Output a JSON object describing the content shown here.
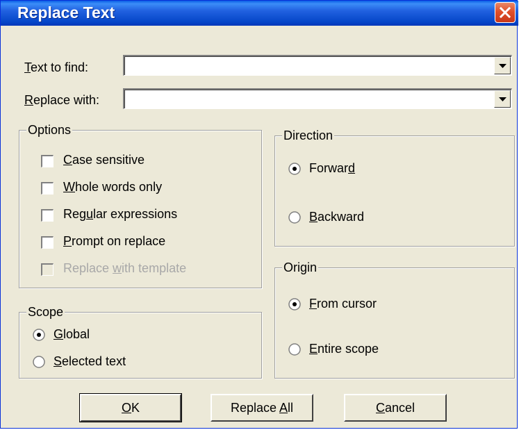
{
  "title": "Replace Text",
  "fields": {
    "find_label": {
      "hot": "T",
      "rest": "ext to find:"
    },
    "find_value": "",
    "replace_label": {
      "hot": "R",
      "rest": "eplace with:"
    },
    "replace_value": ""
  },
  "options": {
    "title": "Options",
    "items": [
      {
        "pre": "",
        "hot": "C",
        "post": "ase sensitive",
        "checked": false,
        "enabled": true
      },
      {
        "pre": "",
        "hot": "W",
        "post": "hole words only",
        "checked": false,
        "enabled": true
      },
      {
        "pre": "Reg",
        "hot": "u",
        "post": "lar expressions",
        "checked": false,
        "enabled": true
      },
      {
        "pre": "",
        "hot": "P",
        "post": "rompt on replace",
        "checked": false,
        "enabled": true
      },
      {
        "pre": "Replace ",
        "hot": "w",
        "post": "ith template",
        "checked": false,
        "enabled": false
      }
    ]
  },
  "scope": {
    "title": "Scope",
    "items": [
      {
        "pre": "",
        "hot": "G",
        "post": "lobal",
        "selected": true
      },
      {
        "pre": "",
        "hot": "S",
        "post": "elected text",
        "selected": false
      }
    ]
  },
  "direction": {
    "title": "Direction",
    "items": [
      {
        "pre": "Forwar",
        "hot": "d",
        "post": "",
        "selected": true
      },
      {
        "pre": "",
        "hot": "B",
        "post": "ackward",
        "selected": false
      }
    ]
  },
  "origin": {
    "title": "Origin",
    "items": [
      {
        "pre": "",
        "hot": "F",
        "post": "rom cursor",
        "selected": true
      },
      {
        "pre": "",
        "hot": "E",
        "post": "ntire scope",
        "selected": false
      }
    ]
  },
  "buttons": {
    "ok": {
      "pre": "",
      "hot": "O",
      "post": "K"
    },
    "replace_all": {
      "pre": "Replace ",
      "hot": "A",
      "post": "ll"
    },
    "cancel": {
      "pre": "",
      "hot": "C",
      "post": "ancel"
    }
  },
  "colors": {
    "titlebar": "#0546C8",
    "face": "#ECE9D8",
    "close": "#E0502A"
  },
  "icons": {
    "close": "close-x-icon",
    "dropdown": "dropdown-arrow-icon"
  }
}
